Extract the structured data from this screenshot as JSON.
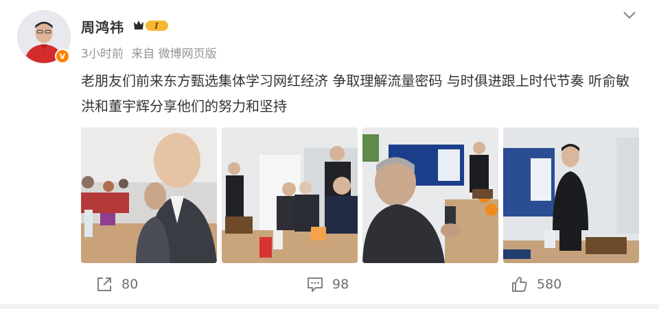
{
  "post": {
    "author": "周鸿祎",
    "level_badge": "I",
    "time": "3小时前",
    "source": "来自 微博网页版",
    "verified_mark": "V",
    "text": "老朋友们前来东方甄选集体学习网红经济 争取理解流量密码 与时俱进跟上时代节奏 听俞敏洪和董宇辉分享他们的努力和坚持"
  },
  "actions": {
    "repost_count": "80",
    "comment_count": "98",
    "like_count": "580"
  },
  "icons": {
    "dropdown": "chevron-down-icon",
    "repost": "share-icon",
    "comment": "comment-icon",
    "like": "thumbs-up-icon"
  },
  "colors": {
    "verified": "#ff8200",
    "level_badge": "#f5a623",
    "meta_text": "#939393"
  }
}
